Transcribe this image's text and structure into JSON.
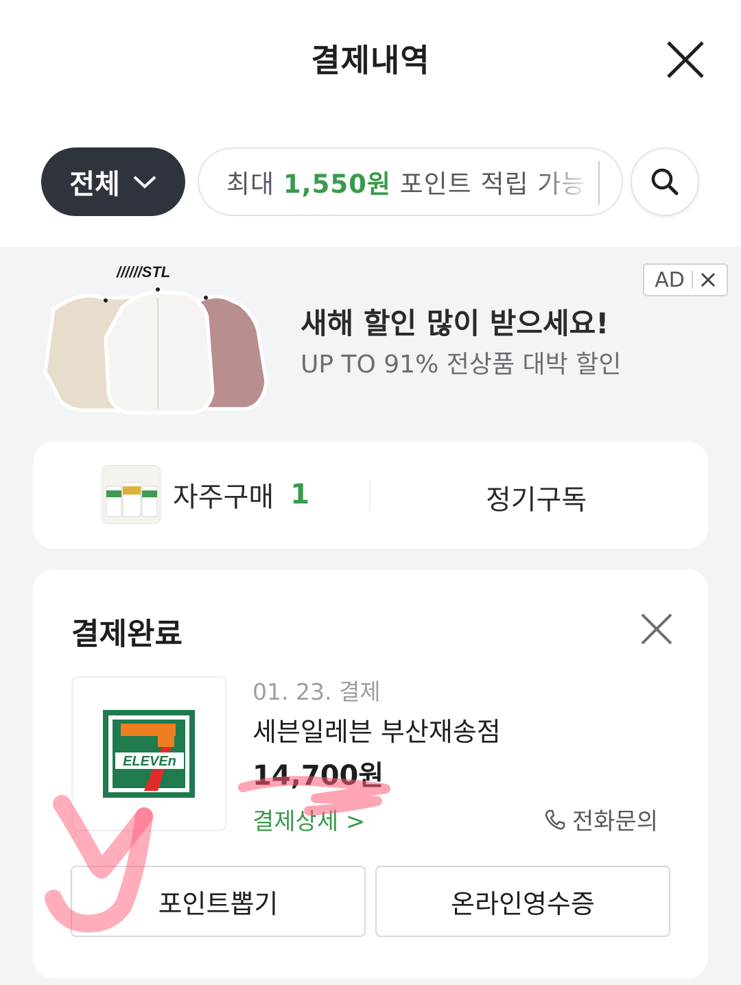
{
  "header": {
    "title": "결제내역"
  },
  "filter": {
    "selected": "전체",
    "search_prefix": "최대 ",
    "search_amount": "1,550원",
    "search_suffix": " 포인트 적립 가능"
  },
  "ad": {
    "badge": "AD",
    "brand": "STL",
    "title": "새해 할인 많이 받으세요!",
    "subtitle": "UP TO 91% 전상품 대박 할인"
  },
  "frequent": {
    "label": "자주구매",
    "count": "1",
    "subscription": "정기구독"
  },
  "payment": {
    "status_title": "결제완료",
    "date": "01. 23. 결제",
    "store_name": "세븐일레븐 부산재송점",
    "amount": "14,700원",
    "detail_label": "결제상세 >",
    "phone_label": "전화문의",
    "point_button": "포인트뽑기",
    "receipt_button": "온라인영수증",
    "logo_text": "ELEVEn"
  },
  "colors": {
    "accent_green": "#3a9a4c",
    "dark_button": "#2f343c",
    "highlight_pink": "#ff5a78"
  }
}
